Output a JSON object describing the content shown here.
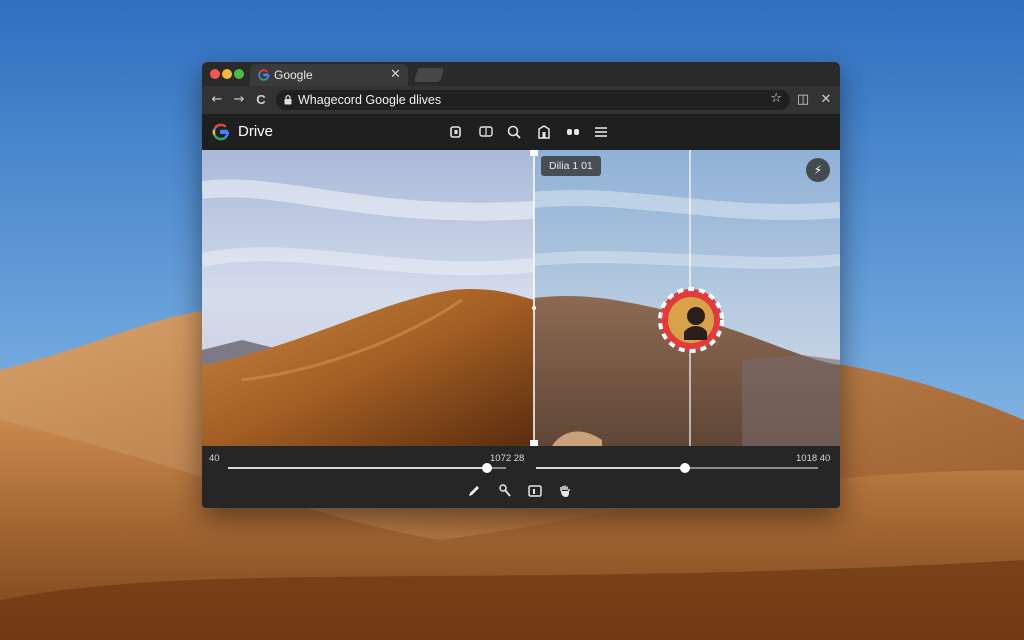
{
  "browser": {
    "tab": {
      "title": "Google",
      "close_glyph": "✕"
    },
    "toolbar": {
      "back_glyph": "←",
      "forward_glyph": "→",
      "reload_glyph": "C",
      "url": "Whagecord Google dlives",
      "bookmark_glyph": "☆",
      "sidebar_glyph": "◫",
      "close_glyph": "✕"
    }
  },
  "app": {
    "title": "Drive",
    "toolbar_icons": [
      "copy-icon",
      "comment-icon",
      "search-icon",
      "save-icon",
      "link-icon",
      "menu-icon"
    ]
  },
  "viewer": {
    "overlay_label": "Dilia 1 01",
    "action_glyph": "⚡"
  },
  "timeline": {
    "left_time": "40",
    "mid_time": "1072 28",
    "right_time": "1018 40",
    "left_progress": 0.93,
    "right_progress": 0.53,
    "tools": [
      "pencil-icon",
      "brush-icon",
      "frame-icon",
      "hand-icon"
    ]
  },
  "colors": {
    "accent_red": "#e23b3b",
    "window_bg": "#222222",
    "sky_blue": "#3d7cc9",
    "dune": "#b8733a"
  }
}
